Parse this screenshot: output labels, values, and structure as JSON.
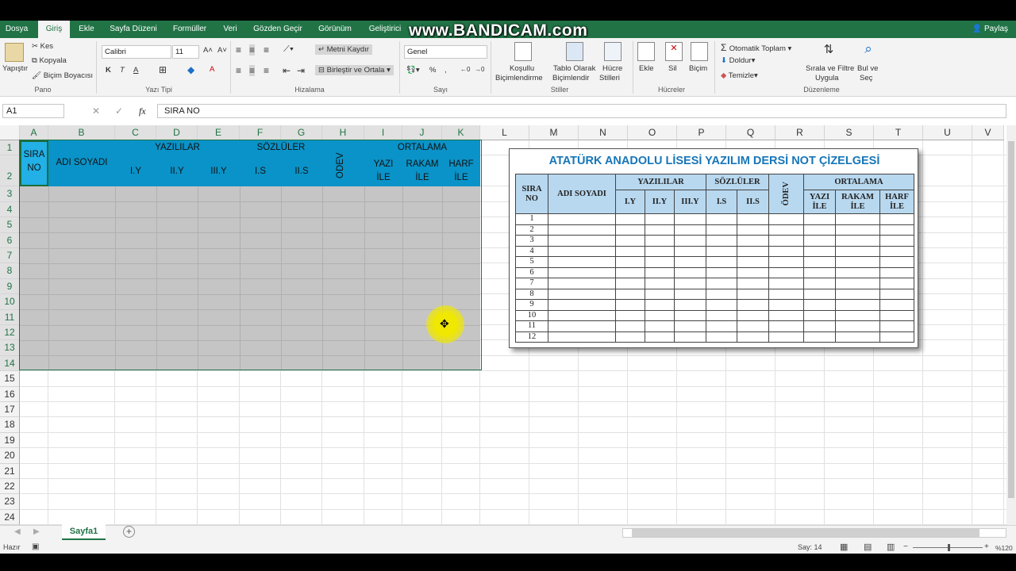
{
  "watermark": "www.BANDICAM.com",
  "share": "Paylaş",
  "tabs": [
    "Dosya",
    "Giriş",
    "Ekle",
    "Sayfa Düzeni",
    "Formüller",
    "Veri",
    "Gözden Geçir",
    "Görünüm",
    "Geliştirici"
  ],
  "ribbon": {
    "paste": "Yapıştır",
    "cut": "Kes",
    "copy": "Kopyala",
    "format_painter": "Biçim Boyacısı",
    "font_name": "Calibri",
    "font_size": "11",
    "bold": "K",
    "italic": "T",
    "underline": "A",
    "wrap_text": "Metni Kaydır",
    "merge_center": "Birleştir ve Ortala",
    "number_format": "Genel",
    "conditional1": "Koşullu",
    "conditional2": "Biçimlendirme",
    "table1": "Tablo Olarak",
    "table2": "Biçimlendir",
    "cell_styles1": "Hücre",
    "cell_styles2": "Stilleri",
    "insert": "Ekle",
    "delete": "Sil",
    "format": "Biçim",
    "autosum": "Otomatik Toplam",
    "fill": "Doldur",
    "clear": "Temizle",
    "sort1": "Sırala ve Filtre",
    "sort2": "Uygula",
    "find1": "Bul ve",
    "find2": "Seç",
    "groups": {
      "clipboard": "Pano",
      "font": "Yazı Tipi",
      "alignment": "Hizalama",
      "number": "Sayı",
      "styles": "Stiller",
      "cells": "Hücreler",
      "editing": "Düzenleme"
    }
  },
  "formula_bar": {
    "name_box": "A1",
    "fx": "fx",
    "content": "SIRA NO"
  },
  "columns": [
    "A",
    "B",
    "C",
    "D",
    "E",
    "F",
    "G",
    "H",
    "I",
    "J",
    "K",
    "L",
    "M",
    "N",
    "O",
    "P",
    "Q",
    "R",
    "S",
    "T",
    "U",
    "V"
  ],
  "rows": [
    "1",
    "2",
    "3",
    "4",
    "5",
    "6",
    "7",
    "8",
    "9",
    "10",
    "11",
    "12",
    "13",
    "14",
    "15",
    "16",
    "17",
    "18",
    "19",
    "20",
    "21",
    "22",
    "23",
    "24"
  ],
  "sheet_header": {
    "sira": "SIRA",
    "no": "NO",
    "adi": "ADI SOYADI",
    "yazililar": "YAZILILAR",
    "sozluler": "SÖZLÜLER",
    "odev": "ÖDEV",
    "ortalama": "ORTALAMA",
    "iy": "I.Y",
    "iiy": "II.Y",
    "iiiy": "III.Y",
    "is": "I.S",
    "iis": "II.S",
    "yazi": "YAZI",
    "rakam": "RAKAM",
    "harf": "HARF",
    "ile": "İLE"
  },
  "reference": {
    "title": "ATATÜRK ANADOLU LİSESİ YAZILIM DERSİ NOT ÇİZELGESİ",
    "sira": "SIRA",
    "no": "NO",
    "adi": "ADI SOYADI",
    "yazililar": "YAZILILAR",
    "sozluler": "SÖZLÜLER",
    "odev": "ÖDEV",
    "ortalama": "ORTALAMA",
    "iy": "I.Y",
    "iiy": "II.Y",
    "iiiy": "III.Y",
    "is": "I.S",
    "iis": "II.S",
    "yazi": "YAZI",
    "rakam": "RAKAM",
    "harf": "HARF",
    "ile": "İLE",
    "numbers": [
      "1",
      "2",
      "3",
      "4",
      "5",
      "6",
      "7",
      "8",
      "9",
      "10",
      "11",
      "12"
    ]
  },
  "sheet_tab": "Sayfa1",
  "status": {
    "ready": "Hazır",
    "count": "Say: 14",
    "zoom": "%120"
  }
}
